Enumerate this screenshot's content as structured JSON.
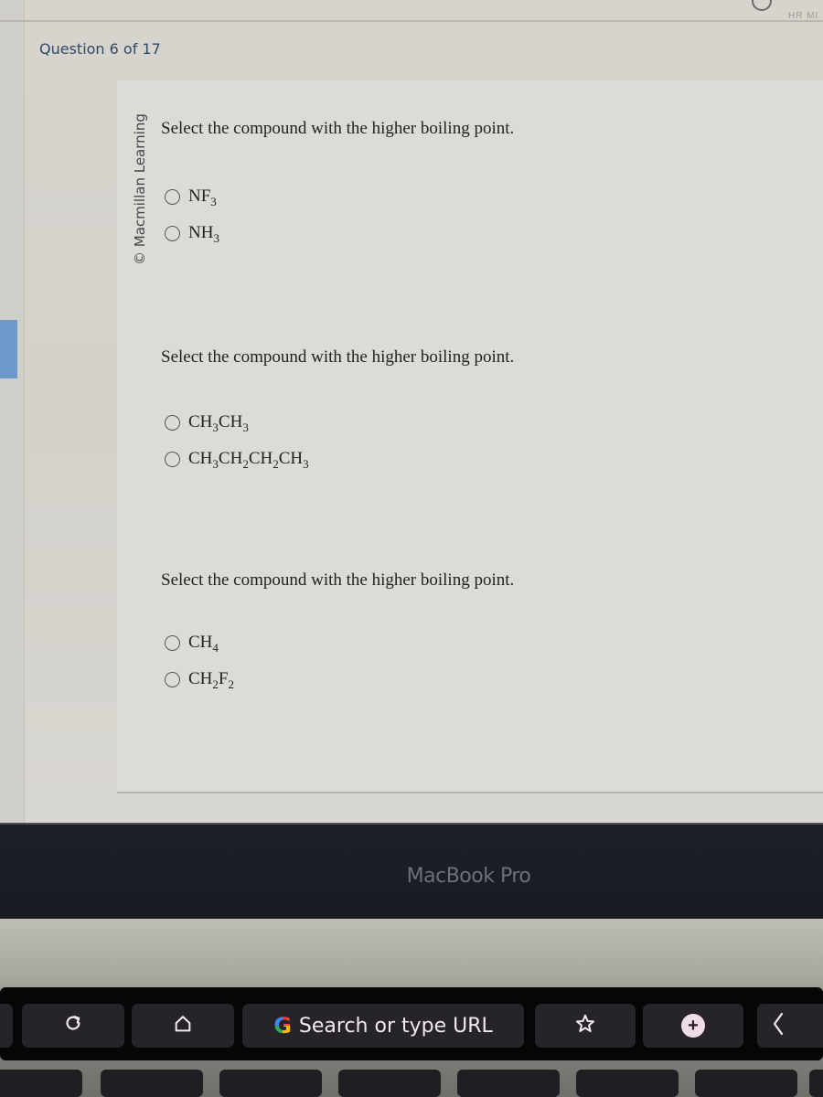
{
  "header": {
    "question_counter": "Question 6 of 17",
    "top_right_text": "HR  MI"
  },
  "sidebar": {
    "copyright": "© Macmillan Learning"
  },
  "questions": [
    {
      "prompt": "Select the compound with the higher boiling point.",
      "options": [
        {
          "label": "NF3",
          "parts": [
            {
              "t": "NF"
            },
            {
              "s": "3"
            }
          ],
          "selected": false
        },
        {
          "label": "NH3",
          "parts": [
            {
              "t": "NH"
            },
            {
              "s": "3"
            }
          ],
          "selected": false
        }
      ]
    },
    {
      "prompt": "Select the compound with the higher boiling point.",
      "options": [
        {
          "label": "CH3CH3",
          "parts": [
            {
              "t": "CH"
            },
            {
              "s": "3"
            },
            {
              "t": "CH"
            },
            {
              "s": "3"
            }
          ],
          "selected": false
        },
        {
          "label": "CH3CH2CH2CH3",
          "parts": [
            {
              "t": "CH"
            },
            {
              "s": "3"
            },
            {
              "t": "CH"
            },
            {
              "s": "2"
            },
            {
              "t": "CH"
            },
            {
              "s": "2"
            },
            {
              "t": "CH"
            },
            {
              "s": "3"
            }
          ],
          "selected": false
        }
      ]
    },
    {
      "prompt": "Select the compound with the higher boiling point.",
      "options": [
        {
          "label": "CH4",
          "parts": [
            {
              "t": "CH"
            },
            {
              "s": "4"
            }
          ],
          "selected": false
        },
        {
          "label": "CH2F2",
          "parts": [
            {
              "t": "CH"
            },
            {
              "s": "2"
            },
            {
              "t": "F"
            },
            {
              "s": "2"
            }
          ],
          "selected": false
        }
      ]
    }
  ],
  "device": {
    "bezel_label": "MacBook Pro"
  },
  "touchbar": {
    "reload_icon": "reload-icon",
    "home_icon": "home-icon",
    "search_placeholder": "Search or type URL",
    "bookmark_icon": "star-icon",
    "new_tab_icon": "plus-circle-icon",
    "collapse_icon": "chevron-left-icon",
    "colors": {
      "background": "#060607",
      "button": "#262428",
      "text": "#f1e9ee"
    }
  },
  "colors": {
    "question_counter": "#2f4a66",
    "side_tab_accent": "#6e98c9"
  }
}
